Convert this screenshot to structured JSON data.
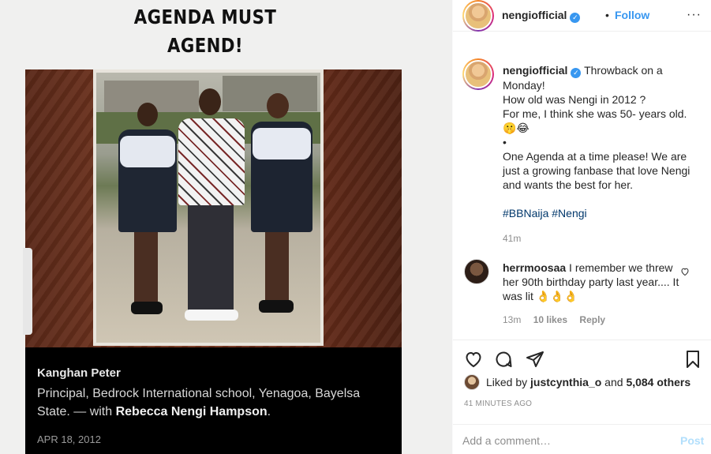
{
  "meme": {
    "title_line1": "AGENDA MUST",
    "title_line2": "AGEND!",
    "caption_name": "Kanghan Peter",
    "caption_text_prefix": "Principal, Bedrock International school, Yenagoa, Bayelsa State. — with ",
    "caption_tagged": "Rebecca Nengi Hampson",
    "caption_suffix": ".",
    "caption_date": "APR 18, 2012"
  },
  "header": {
    "username": "nengiofficial",
    "verified_mark": "✓",
    "separator": "•",
    "follow_label": "Follow",
    "more_icon": "···"
  },
  "caption": {
    "username": "nengiofficial",
    "line1": "Throwback on a Monday!",
    "line2": "How old was Nengi in 2012 ?",
    "line3": "For me, I think she was 50- years old.",
    "emojis": "🤫😂",
    "bullet": "•",
    "line4": "One Agenda at a time please! We are just a growing fanbase that love Nengi and wants the best for her.",
    "hashtag1": "#BBNaija",
    "hashtag2": "#Nengi",
    "time": "41m"
  },
  "reply": {
    "username": "herrmoosaa",
    "text": "I remember we threw her 90th birthday party last year.... It was lit",
    "emojis": "👌👌👌",
    "time": "13m",
    "likes": "10 likes",
    "reply_label": "Reply"
  },
  "likes": {
    "prefix": "Liked by ",
    "user": "justcynthia_o",
    "middle": " and ",
    "count": "5,084 others"
  },
  "timestamp": "41 MINUTES AGO",
  "comment_box": {
    "placeholder": "Add a comment…",
    "post_label": "Post"
  },
  "icons": [
    "heart-icon",
    "comment-icon",
    "share-icon",
    "bookmark-icon"
  ]
}
